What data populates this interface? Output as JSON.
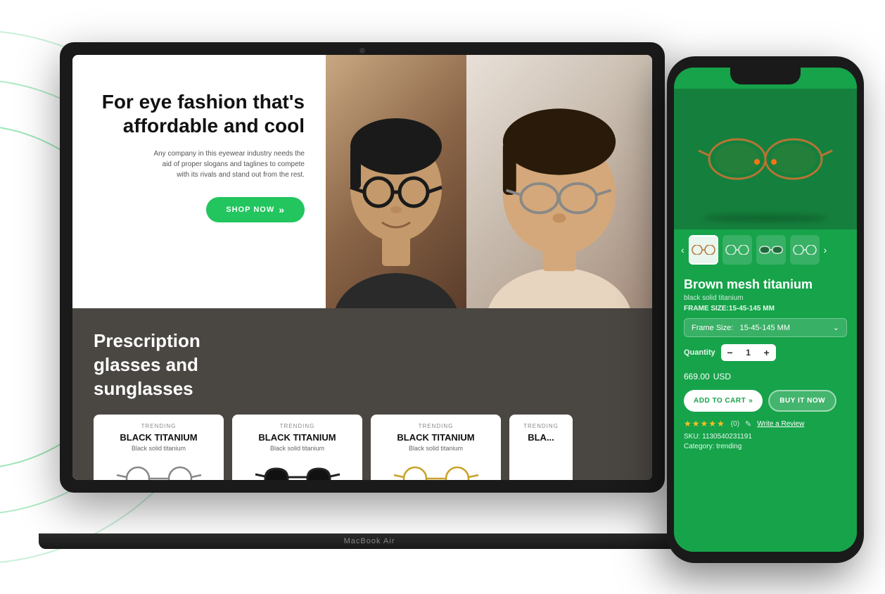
{
  "scene": {
    "background_color": "#ffffff"
  },
  "circles": {
    "color": "#22c55e"
  },
  "laptop": {
    "brand_label": "MacBook Air",
    "hero": {
      "title": "For eye fashion that's affordable and cool",
      "subtitle": "Any company in this eyewear industry needs the aid of proper slogans and taglines to compete with its rivals and stand out from the rest.",
      "shop_now_button": "SHOP NOW"
    },
    "section2": {
      "title": "Prescription glasses and sunglasses",
      "products": [
        {
          "trending": "TRENDING",
          "name": "BLACK TITANIUM",
          "desc": "Black solid titanium"
        },
        {
          "trending": "TRENDING",
          "name": "BLACK TITANIUM",
          "desc": "Black solid titanium"
        },
        {
          "trending": "TRENDING",
          "name": "BLACK TITANIUM",
          "desc": "Black solid titanium"
        },
        {
          "trending": "TRENDING",
          "name": "BLA...",
          "desc": ""
        }
      ]
    }
  },
  "phone": {
    "product_title": "Brown mesh titanium",
    "product_subtitle": "black solid titanium",
    "frame_size_label": "FRAME SIZE:15-45-145 MM",
    "frame_size_select_label": "Frame Size:",
    "frame_size_value": "15-45-145 MM",
    "quantity_label": "Quantity",
    "quantity_value": "1",
    "price": "669.00",
    "currency": "USD",
    "add_to_cart_label": "ADD TO CART",
    "buy_it_now_label": "BUY IT NOW",
    "rating": "(0)",
    "write_review_label": "Write a Review",
    "sku_label": "SKU: 1130540231191",
    "category_label": "Category: trending",
    "thumbnails": [
      "glasses1",
      "glasses2",
      "glasses3",
      "glasses4"
    ]
  }
}
